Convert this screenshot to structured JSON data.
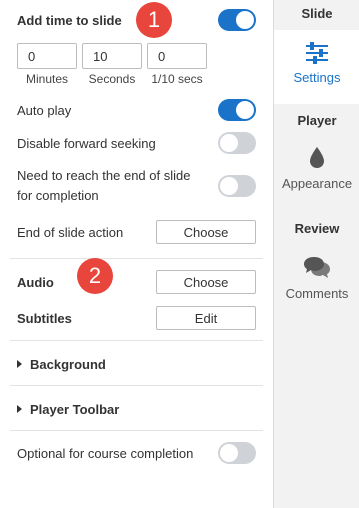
{
  "add_time": {
    "label": "Add time to slide",
    "enabled": true
  },
  "time_fields": [
    {
      "value": "0",
      "caption": "Minutes"
    },
    {
      "value": "10",
      "caption": "Seconds"
    },
    {
      "value": "0",
      "caption": "1/10 secs"
    }
  ],
  "auto_play": {
    "label": "Auto play",
    "enabled": true
  },
  "disable_seek": {
    "label": "Disable forward seeking",
    "enabled": false
  },
  "need_end": {
    "label_line1": "Need to reach the end of slide",
    "label_line2": "for completion",
    "enabled": false
  },
  "end_action": {
    "label": "End of slide action",
    "button": "Choose"
  },
  "audio": {
    "label": "Audio",
    "button": "Choose"
  },
  "subtitles": {
    "label": "Subtitles",
    "button": "Edit"
  },
  "sections": {
    "background": "Background",
    "player_toolbar": "Player Toolbar"
  },
  "optional": {
    "label": "Optional for course completion",
    "enabled": false
  },
  "badges": {
    "first": "1",
    "second": "2"
  },
  "sidebar": {
    "slide_header": "Slide",
    "settings_label": "Settings",
    "player_header": "Player",
    "appearance_label": "Appearance",
    "review_header": "Review",
    "comments_label": "Comments"
  },
  "colors": {
    "accent": "#1a73c9",
    "badge": "#e8453c",
    "toggle_off": "#cfd3d8"
  },
  "icons": {
    "settings": "sliders-icon",
    "appearance": "drop-icon",
    "comments": "chat-bubbles-icon"
  }
}
